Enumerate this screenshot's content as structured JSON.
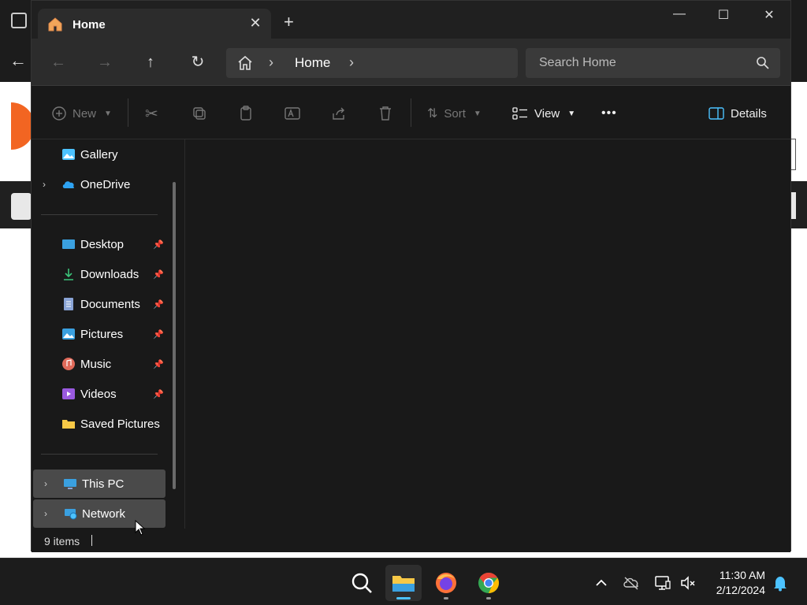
{
  "tab": {
    "title": "Home"
  },
  "address": {
    "location": "Home"
  },
  "search": {
    "placeholder": "Search Home"
  },
  "toolbar": {
    "new_label": "New",
    "sort_label": "Sort",
    "view_label": "View",
    "more_label": "•••",
    "details_label": "Details"
  },
  "sidebar": {
    "items": [
      {
        "label": "Gallery"
      },
      {
        "label": "OneDrive"
      },
      {
        "label": "Desktop"
      },
      {
        "label": "Downloads"
      },
      {
        "label": "Documents"
      },
      {
        "label": "Pictures"
      },
      {
        "label": "Music"
      },
      {
        "label": "Videos"
      },
      {
        "label": "Saved Pictures"
      },
      {
        "label": "This PC"
      },
      {
        "label": "Network"
      }
    ]
  },
  "status": {
    "item_count": "9 items"
  },
  "taskbar": {
    "time": "11:30 AM",
    "date": "2/12/2024"
  },
  "colors": {
    "window_bg": "#191919",
    "navbar_bg": "#2c2c2c",
    "accent": "#4cc2ff"
  }
}
